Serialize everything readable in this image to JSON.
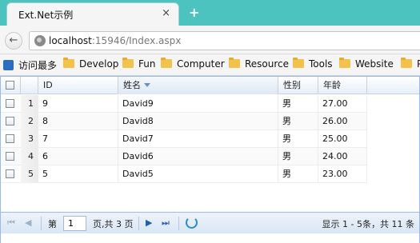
{
  "browser": {
    "tab_title": "Ext.Net示例",
    "tab_close": "×",
    "new_tab": "+",
    "back": "←",
    "forward": "→",
    "url_host": "localhost",
    "url_rest": ":15946/Index.aspx",
    "bookmarks": [
      {
        "label": "访问最多",
        "icon": "apps-icon"
      },
      {
        "label": "Develop",
        "icon": "folder-icon"
      },
      {
        "label": "Fun",
        "icon": "folder-icon"
      },
      {
        "label": "Computer",
        "icon": "folder-icon"
      },
      {
        "label": "Resource",
        "icon": "folder-icon"
      },
      {
        "label": "Tools",
        "icon": "folder-icon"
      },
      {
        "label": "Website",
        "icon": "folder-icon"
      },
      {
        "label": "P",
        "icon": "folder-icon"
      }
    ]
  },
  "grid": {
    "columns": {
      "id": "ID",
      "name": "姓名",
      "gender": "性别",
      "age": "年龄"
    },
    "sorted_column": "name",
    "rows": [
      {
        "num": "1",
        "id": "9",
        "name": "David9",
        "gender": "男",
        "age": "27.00"
      },
      {
        "num": "2",
        "id": "8",
        "name": "David8",
        "gender": "男",
        "age": "26.00"
      },
      {
        "num": "3",
        "id": "7",
        "name": "David7",
        "gender": "男",
        "age": "25.00"
      },
      {
        "num": "4",
        "id": "6",
        "name": "David6",
        "gender": "男",
        "age": "24.00"
      },
      {
        "num": "5",
        "id": "5",
        "name": "David5",
        "gender": "男",
        "age": "23.00"
      }
    ],
    "pager": {
      "first": "⏮",
      "prev": "◀",
      "page_label": "第",
      "page_value": "1",
      "page_total": "页,共 3 页",
      "next": "▶",
      "last": "⏭",
      "info": "显示 1 - 5条，共 11 条"
    }
  }
}
